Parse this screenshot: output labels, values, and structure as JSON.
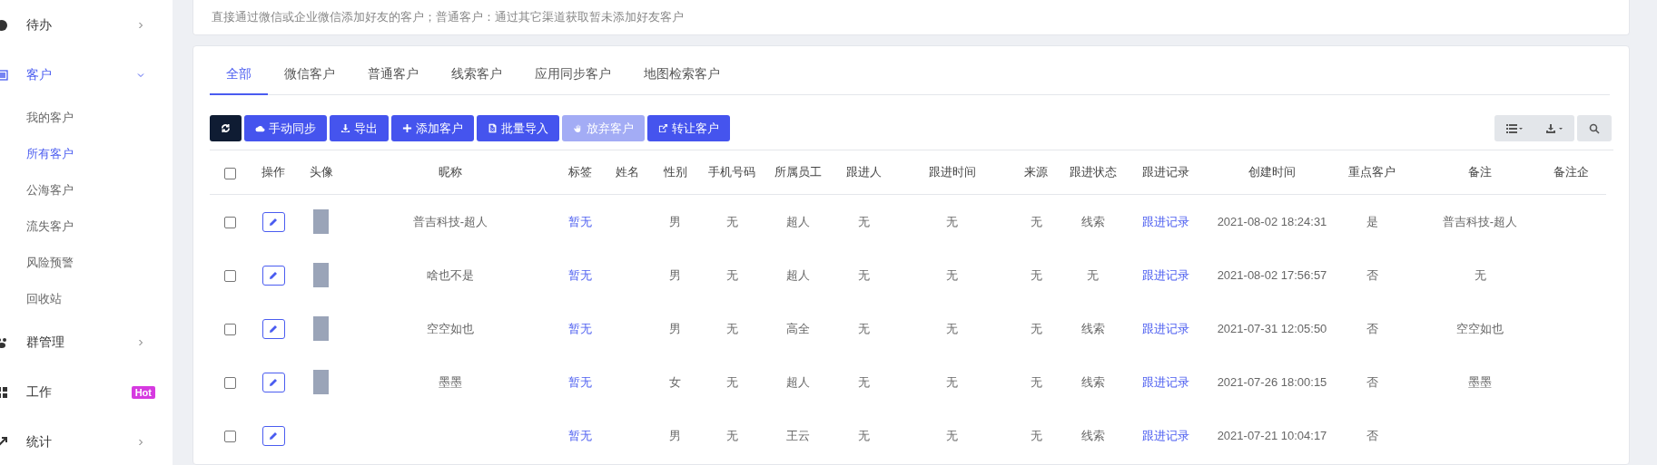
{
  "sidebar": {
    "items": [
      {
        "label": "待办",
        "expanded": false,
        "selected": false
      },
      {
        "label": "客户",
        "expanded": true,
        "selected": true,
        "children": [
          {
            "label": "我的客户",
            "selected": false
          },
          {
            "label": "所有客户",
            "selected": true
          },
          {
            "label": "公海客户",
            "selected": false
          },
          {
            "label": "流失客户",
            "selected": false
          },
          {
            "label": "风险预警",
            "selected": false
          },
          {
            "label": "回收站",
            "selected": false
          }
        ]
      },
      {
        "label": "群管理",
        "expanded": false,
        "selected": false
      },
      {
        "label": "工作",
        "expanded": false,
        "selected": false,
        "badge": "Hot"
      },
      {
        "label": "统计",
        "expanded": false,
        "selected": false
      }
    ]
  },
  "notice": "直接通过微信或企业微信添加好友的客户；普通客户：通过其它渠道获取暂未添加好友客户",
  "tabs": [
    {
      "label": "全部",
      "selected": true
    },
    {
      "label": "微信客户",
      "selected": false
    },
    {
      "label": "普通客户",
      "selected": false
    },
    {
      "label": "线索客户",
      "selected": false
    },
    {
      "label": "应用同步客户",
      "selected": false
    },
    {
      "label": "地图检索客户",
      "selected": false
    }
  ],
  "toolbar": [
    {
      "kind": "dark",
      "disabled": false
    },
    {
      "label": "手动同步",
      "kind": "primary",
      "disabled": false
    },
    {
      "label": "导出",
      "kind": "primary",
      "disabled": false
    },
    {
      "label": "添加客户",
      "kind": "primary",
      "disabled": false
    },
    {
      "label": "批量导入",
      "kind": "primary",
      "disabled": false
    },
    {
      "label": "放弃客户",
      "kind": "primary",
      "disabled": true
    },
    {
      "label": "转让客户",
      "kind": "primary",
      "disabled": false
    }
  ],
  "table": {
    "select_all": {
      "checked": false
    },
    "columns": [
      "操作",
      "头像",
      "昵称",
      "标签",
      "姓名",
      "性别",
      "手机号码",
      "所属员工",
      "跟进人",
      "跟进时间",
      "来源",
      "跟进状态",
      "跟进记录",
      "创建时间",
      "重点客户",
      "备注",
      "备注企"
    ],
    "rows": [
      {
        "checked": false,
        "avatar": true,
        "nickname": "普吉科技-超人",
        "tag": "暂无",
        "gender": "男",
        "phone": "无",
        "staff": "超人",
        "follower": "无",
        "follow_time": "无",
        "source": "无",
        "status": "线索",
        "record": "跟进记录",
        "created": "2021-08-02 18:24:31",
        "key": "是",
        "remark": "普吉科技-超人"
      },
      {
        "checked": false,
        "avatar": true,
        "nickname": "啥也不是",
        "tag": "暂无",
        "gender": "男",
        "phone": "无",
        "staff": "超人",
        "follower": "无",
        "follow_time": "无",
        "source": "无",
        "status": "无",
        "record": "跟进记录",
        "created": "2021-08-02 17:56:57",
        "key": "否",
        "remark": "无"
      },
      {
        "checked": false,
        "avatar": true,
        "nickname": "空空如也",
        "tag": "暂无",
        "gender": "男",
        "phone": "无",
        "staff": "高全",
        "follower": "无",
        "follow_time": "无",
        "source": "无",
        "status": "线索",
        "record": "跟进记录",
        "created": "2021-07-31 12:05:50",
        "key": "否",
        "remark": "空空如也"
      },
      {
        "checked": false,
        "avatar": true,
        "nickname": "墨墨",
        "tag": "暂无",
        "gender": "女",
        "phone": "无",
        "staff": "超人",
        "follower": "无",
        "follow_time": "无",
        "source": "无",
        "status": "线索",
        "record": "跟进记录",
        "created": "2021-07-26 18:00:15",
        "key": "否",
        "remark": "墨墨"
      },
      {
        "checked": false,
        "avatar": false,
        "tag": "暂无",
        "gender": "男",
        "phone": "无",
        "staff": "王云",
        "follower": "无",
        "follow_time": "无",
        "source": "无",
        "status": "线索",
        "record": "跟进记录",
        "created": "2021-07-21 10:04:17",
        "key": "否"
      }
    ]
  }
}
